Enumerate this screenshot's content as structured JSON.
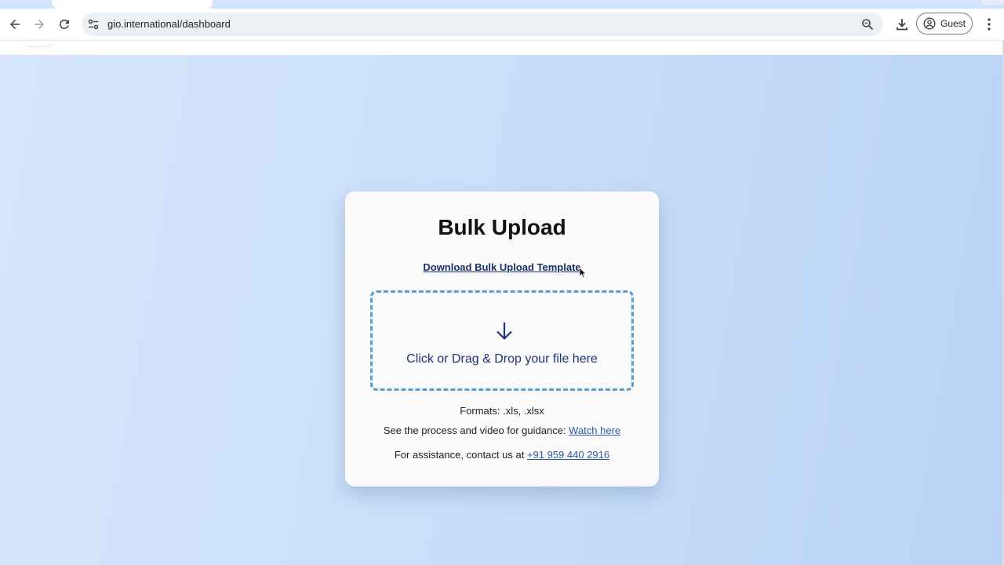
{
  "browser": {
    "url": "gio.international/dashboard",
    "profile_label": "Guest",
    "icons": {
      "back": "arrow-left-icon",
      "forward": "arrow-right-icon",
      "reload": "reload-icon",
      "site_info": "tune-icon",
      "zoom": "zoom-icon",
      "download": "download-icon",
      "profile": "account-circle-icon",
      "menu": "kebab-menu-icon"
    },
    "colors": {
      "tabstrip": "#d3e3fd",
      "omnibox": "#edf0f4"
    }
  },
  "card": {
    "title": "Bulk Upload",
    "template_link": "Download Bulk Upload Template",
    "dropzone_text": "Click or Drag & Drop your file here",
    "formats": "Formats: .xls, .xlsx",
    "guidance_prefix": "See the process and video for guidance: ",
    "guidance_link": "Watch here",
    "assist_prefix": "For assistance, contact us at ",
    "assist_phone": "+91 959 440 2916",
    "colors": {
      "dropzone_border": "#5b9ccf",
      "dropzone_text": "#1d3478",
      "link": "#2a5ba8"
    }
  }
}
